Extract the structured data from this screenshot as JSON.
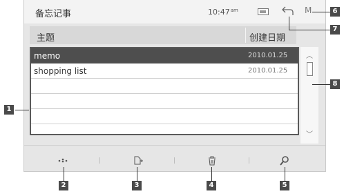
{
  "status_bar": {
    "app_title": "备忘记事",
    "time": "10:47",
    "time_suffix": "am",
    "menu_label": "M"
  },
  "list": {
    "header": {
      "subject": "主题",
      "created_date": "创建日期"
    },
    "rows": [
      {
        "title": "memo",
        "date": "2010.01.25",
        "selected": true
      },
      {
        "title": "shopping list",
        "date": "2010.01.25",
        "selected": false
      }
    ]
  },
  "toolbar": {
    "buttons": [
      "more-icon",
      "new-memo-icon",
      "delete-icon",
      "search-icon"
    ]
  },
  "callouts": [
    "1",
    "2",
    "3",
    "4",
    "5",
    "6",
    "7",
    "8"
  ]
}
